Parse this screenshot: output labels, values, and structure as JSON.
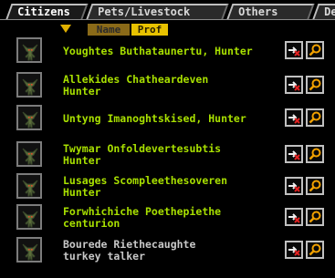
{
  "tabs": [
    "Citizens",
    "Pets/Livestock",
    "Others",
    "Dea"
  ],
  "sort": {
    "name_label": "Name",
    "prof_label": "Prof"
  },
  "units": [
    {
      "line1": "Youghtes Buthataunertu, Hunter",
      "line2": "",
      "dim": false
    },
    {
      "line1": "Allekides Chatheardeven",
      "line2": "Hunter",
      "dim": false
    },
    {
      "line1": "Untyng Imanoghtskised, Hunter",
      "line2": "",
      "dim": false
    },
    {
      "line1": "Twymar Onfoldevertesubtis",
      "line2": "Hunter",
      "dim": false
    },
    {
      "line1": "Lusages Scompleethesoveren",
      "line2": "Hunter",
      "dim": false
    },
    {
      "line1": "Forwhichiche Poethepiethe",
      "line2": "centurion",
      "dim": false
    },
    {
      "line1": "Bourede Riethecaughte",
      "line2": "turkey talker",
      "dim": true
    }
  ],
  "icons": {
    "portrait": "goblin-portrait-icon",
    "assign": "assign-arrow-x-icon",
    "zoom": "magnifier-icon",
    "sort": "sort-down-arrow-icon"
  },
  "colors": {
    "accent_text": "#a8e000",
    "dim_text": "#c8c8c8",
    "sort_prof_bg": "#e8c200",
    "sort_name_bg": "#8a6a18",
    "tab_bg": "#2a2a2a"
  }
}
